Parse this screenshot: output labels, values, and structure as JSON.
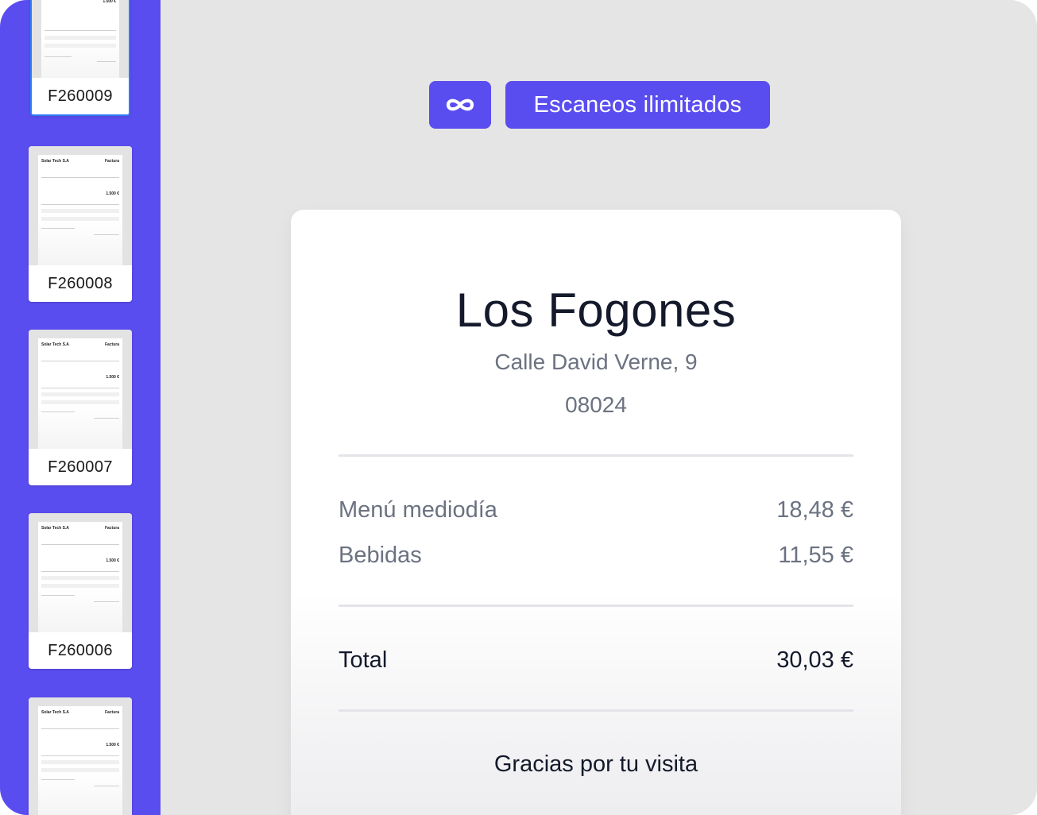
{
  "sidebar": {
    "documents": [
      {
        "label": "F260009",
        "selected": true
      },
      {
        "label": "F260008",
        "selected": false
      },
      {
        "label": "F260007",
        "selected": false
      },
      {
        "label": "F260006",
        "selected": false
      },
      {
        "label": "",
        "selected": false
      }
    ],
    "thumbnail": {
      "company": "Solar Tech S.A",
      "doc_type": "Factura",
      "amount": "1.500 €"
    }
  },
  "toolbar": {
    "infinity_icon": "∞",
    "unlimited_label": "Escaneos ilimitados"
  },
  "receipt": {
    "name": "Los Fogones",
    "address": "Calle David Verne, 9",
    "zip": "08024",
    "items": [
      {
        "label": "Menú mediodía",
        "amount": "18,48 €"
      },
      {
        "label": "Bebidas",
        "amount": "11,55 €"
      }
    ],
    "total_label": "Total",
    "total_amount": "30,03 €",
    "thanks": "Gracias por tu visita"
  },
  "colors": {
    "accent": "#5a4df0",
    "background": "#e6e5e5",
    "text_dark": "#141a2b",
    "text_muted": "#6b7280"
  }
}
